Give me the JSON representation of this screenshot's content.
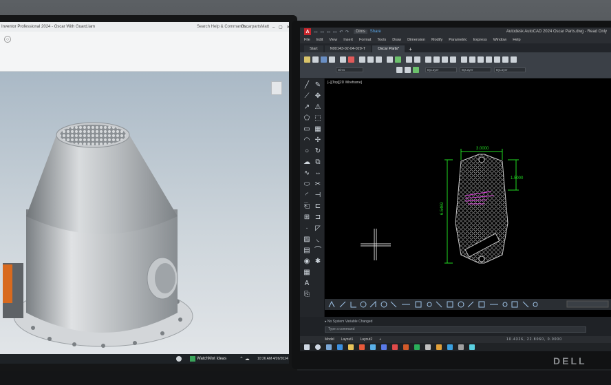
{
  "inventor": {
    "title": "Inventor Professional 2024 - Oscar With Guard.iam",
    "search": "Search Help & Commands...",
    "user": "OscarpartsMatt",
    "window_controls": "– ▢ ✕",
    "ribbon_icon": "○",
    "viewcube_label": "",
    "taskbar": {
      "app_label": "WatchMot Ideas",
      "tray": "⌃ ☁",
      "clock": "10:26 AM\n4/26/2024"
    }
  },
  "autocad": {
    "logo": "A",
    "quick_access": "▭ ▭ ▭ ▭ ↶ ↷",
    "workspace": "Dims",
    "share": "Share",
    "app_title": "Autodesk AutoCAD 2024   Oscar Parts.dwg - Read Only",
    "menu": [
      "File",
      "Edit",
      "View",
      "Insert",
      "Format",
      "Tools",
      "Draw",
      "Dimension",
      "Modify",
      "Parametric",
      "Express",
      "Window",
      "Help"
    ],
    "tabs": [
      {
        "label": "Start",
        "active": false
      },
      {
        "label": "N00143-02-04-029-T",
        "active": false
      },
      {
        "label": "Oscar Parts*",
        "active": true
      },
      {
        "label": "+",
        "active": false
      }
    ],
    "ribbon_dropdowns": [
      "Dims",
      "ByLayer",
      "ByLayer",
      "ByLayer"
    ],
    "viewport_label": "[–][Top][2D Wireframe]",
    "dimensions": {
      "width": "3.0000",
      "height": "6.5469",
      "small": "1.5000"
    },
    "command_history": "▸ No System Variable Changed",
    "command_prompt": "Type a command",
    "layout_tabs": [
      "Model",
      "Layout1",
      "Layout2",
      "+"
    ],
    "coords": "10.4326, 22.8060, 0.0000",
    "brand": "DELL"
  },
  "colors": {
    "dimension_green": "#22dd22",
    "part_gray": "#c8c8c8",
    "selection_magenta": "#e040e0",
    "autocad_red": "#c8262c"
  }
}
